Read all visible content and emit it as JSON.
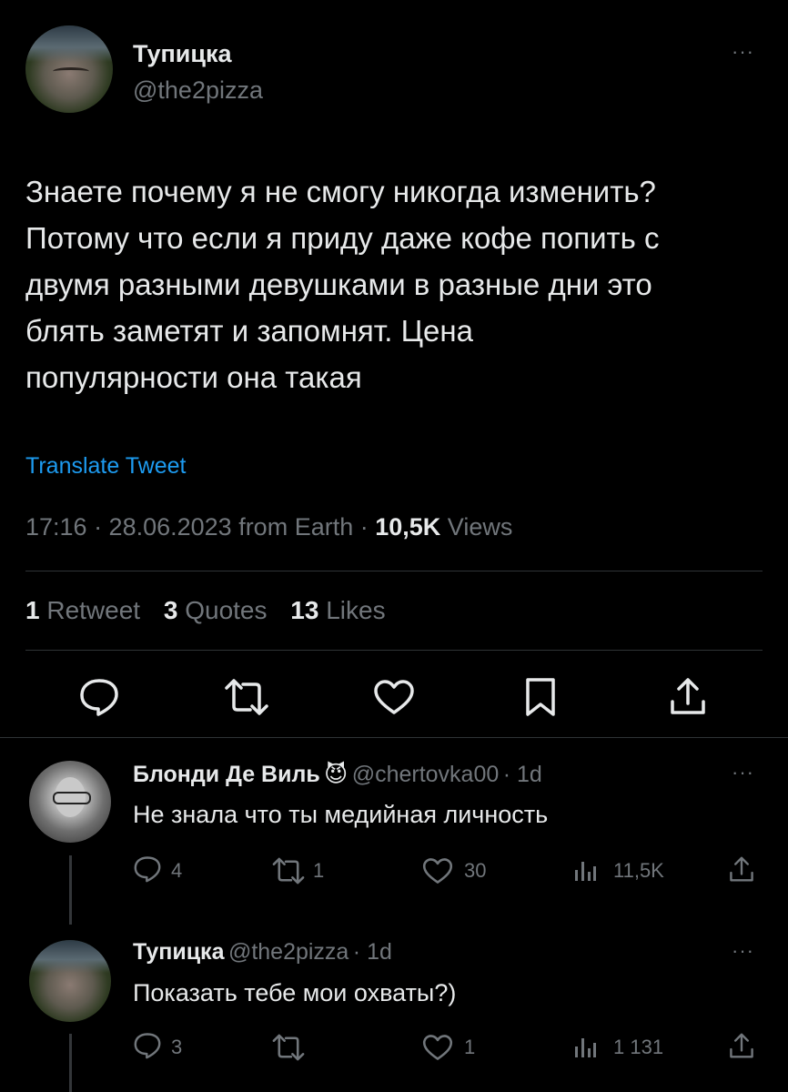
{
  "tweet": {
    "author_name": "Тупицка",
    "author_handle": "@the2pizza",
    "text": "Знаете почему я не смогу никогда изменить?\nПотому что если я приду даже кофе попить с\nдвумя разными девушками в разные дни это\nблять заметят и запомнят. Цена\nпопулярности она такая",
    "translate_label": "Translate Tweet",
    "timestamp": "17:16 · 28.06.2023 from Earth · ",
    "views_count": "10,5K",
    "views_label": " Views",
    "retweets_count": "1",
    "retweets_label": "Retweet",
    "quotes_count": "3",
    "quotes_label": "Quotes",
    "likes_count": "13",
    "likes_label": "Likes",
    "more": "···"
  },
  "replies": [
    {
      "author_name": "Блонди Де Виль",
      "emoji": "😈",
      "author_handle": "@chertovka00",
      "age": "· 1d",
      "text": "Не знала что ты медийная личность",
      "reply_count": "4",
      "retweet_count": "1",
      "like_count": "30",
      "view_count": "11,5K",
      "more": "···"
    },
    {
      "author_name": "Тупицка",
      "author_handle": "@the2pizza",
      "age": "· 1d",
      "text": "Показать тебе мои охваты?)",
      "reply_count": "3",
      "retweet_count": "",
      "like_count": "1",
      "view_count": "1 131",
      "more": "···"
    }
  ],
  "colors": {
    "background": "#000000",
    "text": "#e7e9ea",
    "muted": "#71767b",
    "link": "#1d9bf0",
    "divider": "#2f3336"
  },
  "icons": [
    "reply-icon",
    "retweet-icon",
    "like-icon",
    "bookmark-icon",
    "share-icon",
    "views-icon",
    "more-icon",
    "devil-emoji-icon"
  ]
}
